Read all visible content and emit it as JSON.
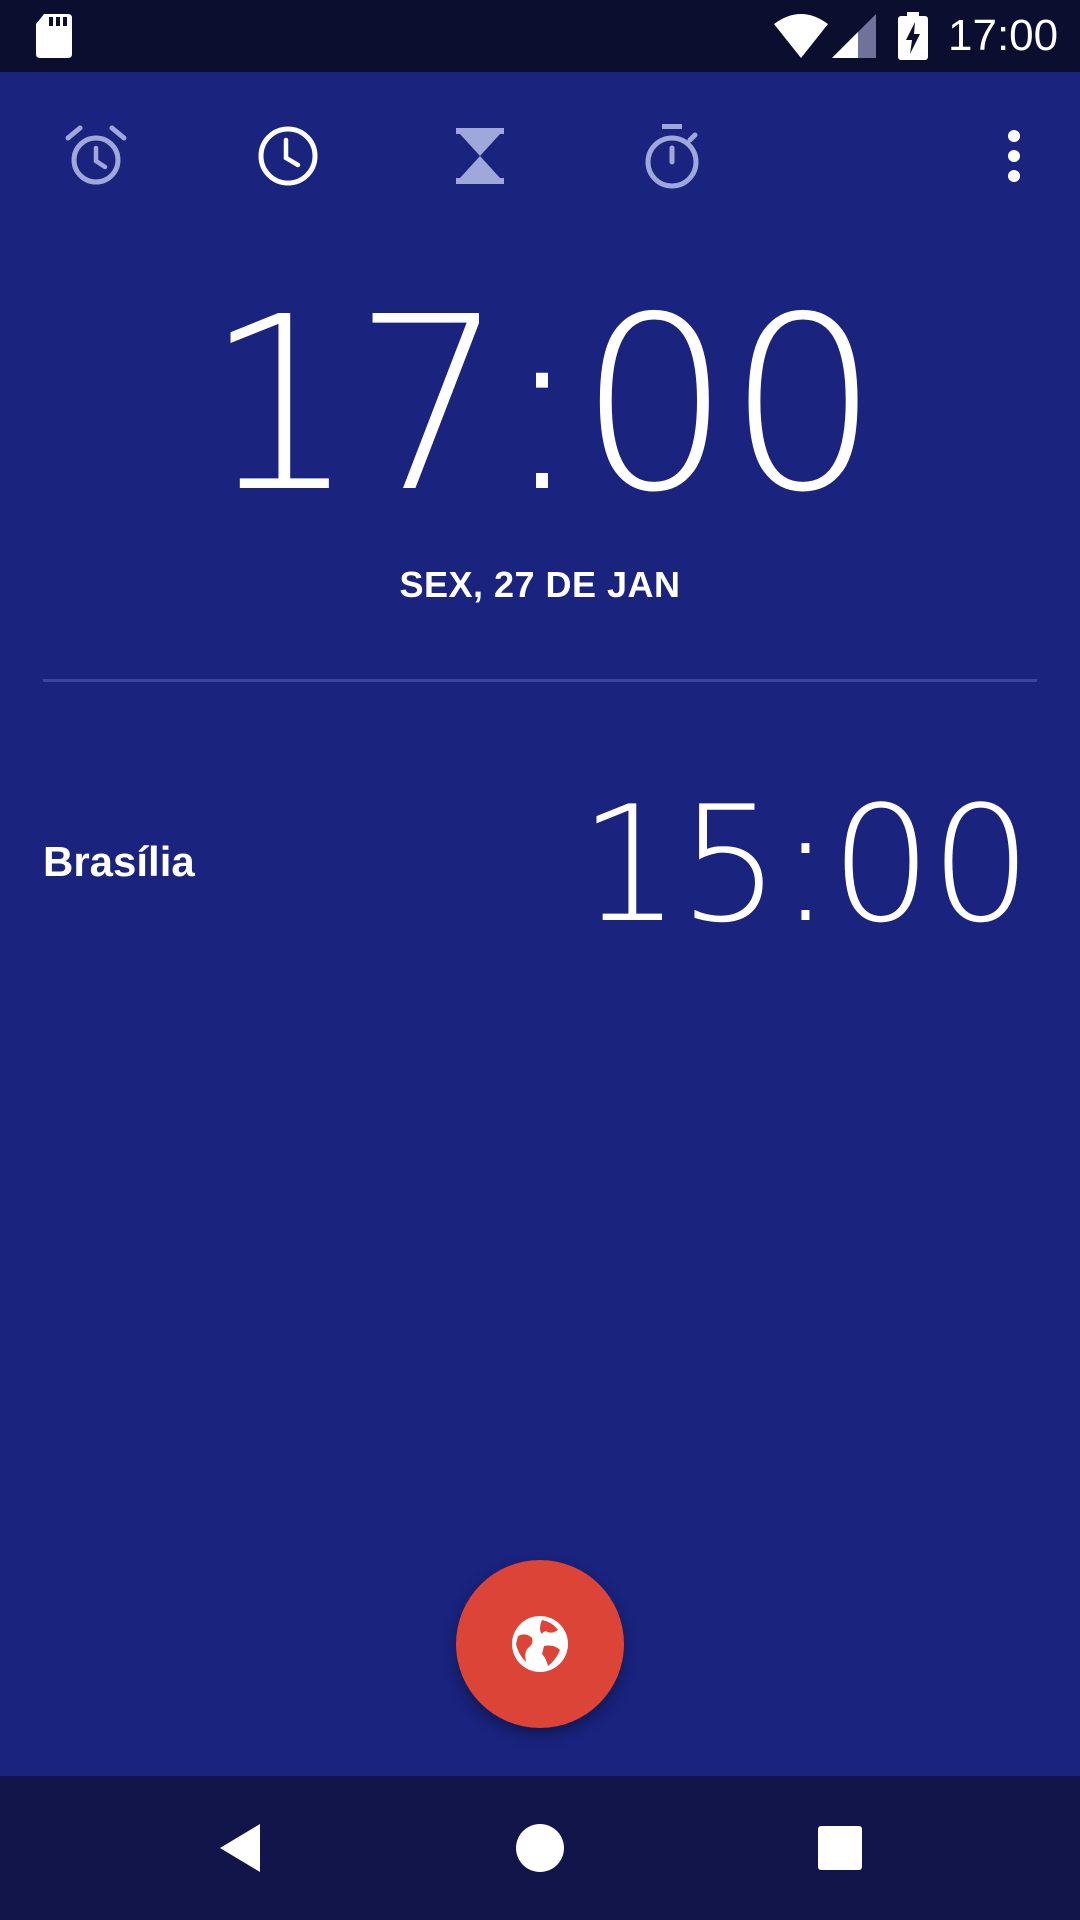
{
  "status_bar": {
    "time": "17:00",
    "icons": [
      "sd-card-icon",
      "wifi-icon",
      "cell-signal-icon",
      "battery-charging-icon"
    ]
  },
  "tabs": [
    {
      "name": "alarm",
      "icon": "alarm-icon",
      "active": false
    },
    {
      "name": "clock",
      "icon": "clock-icon",
      "active": true
    },
    {
      "name": "timer",
      "icon": "hourglass-icon",
      "active": false
    },
    {
      "name": "stopwatch",
      "icon": "stopwatch-icon",
      "active": false
    }
  ],
  "overflow_menu_icon": "more-vert-icon",
  "main": {
    "time": "17:00",
    "date": "SEX, 27 DE JAN"
  },
  "world_clocks": [
    {
      "city": "Brasília",
      "time": "15:00"
    }
  ],
  "fab": {
    "icon": "globe-icon"
  },
  "nav_bar": {
    "icons": [
      "back-icon",
      "home-icon",
      "recents-icon"
    ]
  },
  "colors": {
    "background": "#1a237e",
    "status_bar": "#0b0e2e",
    "nav_bar": "#11154a",
    "fab": "#db4437",
    "inactive_icon": "#9fa8da",
    "active_icon": "#ffffff",
    "divider": "#3a43a0"
  }
}
